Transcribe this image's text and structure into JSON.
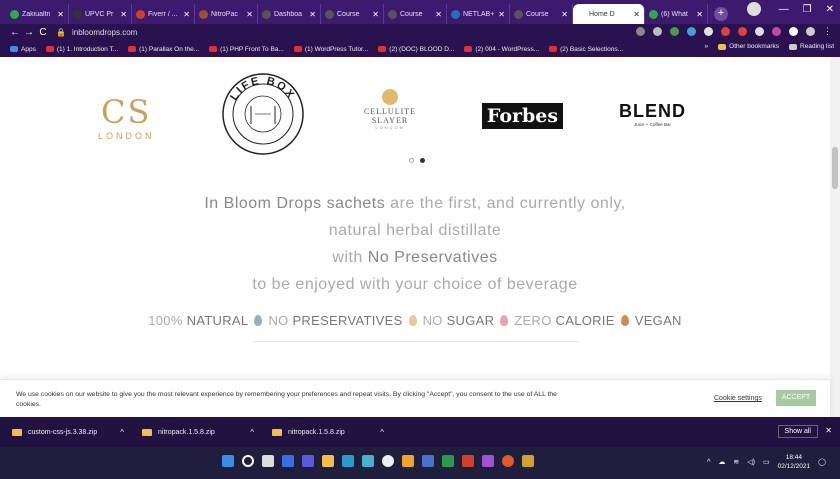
{
  "browser": {
    "tabs": [
      {
        "label": "Zakiualtn",
        "color": "#2eaa4a"
      },
      {
        "label": "UPVC Pr",
        "color": "#333333"
      },
      {
        "label": "Fiverr / ...",
        "color": "#d04030"
      },
      {
        "label": "NitroPac",
        "color": "#a05030"
      },
      {
        "label": "Dashboa",
        "color": "#555555"
      },
      {
        "label": "Course",
        "color": "#555555"
      },
      {
        "label": "Course",
        "color": "#555555"
      },
      {
        "label": "NETLAB+",
        "color": "#2a6cc0"
      },
      {
        "label": "Course",
        "color": "#555555"
      },
      {
        "label": "Home D",
        "color": "#ffffff",
        "active": true
      },
      {
        "label": "(6) What",
        "color": "#2eaa4a"
      }
    ],
    "new_tab": "+",
    "url": "inbloomdrops.com",
    "bookmarks": [
      "Apps",
      "(1) 1. Introduction T...",
      "(1) Parallax On the...",
      "(1) PHP Front To Ba...",
      "(1) WordPress Tutor...",
      "(2) (DOC) BLOOD D...",
      "(2) 004 - WordPress...",
      "(2) Basic Selections..."
    ],
    "bookmarks_more": "»",
    "other_bookmarks": "Other bookmarks",
    "reading_list": "Reading list"
  },
  "logos": {
    "cs_big": "CS",
    "cs_small": "LONDON",
    "lifebox": "LIFE BOX",
    "cellulite_name": "CELLULITE SLAYER",
    "cellulite_loc": "LONDON",
    "forbes": "Forbes",
    "blend": "BLEND",
    "blend_sub": "Juice + Coffee Bar"
  },
  "copy": {
    "line1_a": "In Bloom Drops sachets",
    "line1_b": " are the first, and currently only,",
    "line2": "natural herbal distillate",
    "line3_a": "with ",
    "line3_b": "No Preservatives",
    "line4": "to be enjoyed with your choice of beverage"
  },
  "attributes": [
    {
      "pre": "100% ",
      "word": "NATURAL",
      "drop": "#8fb3b8"
    },
    {
      "pre": "NO ",
      "word": "PRESERVATIVES",
      "drop": "#f0c49a"
    },
    {
      "pre": "NO ",
      "word": "SUGAR",
      "drop": "#f0a0a8"
    },
    {
      "pre": "ZERO ",
      "word": "CALORIE",
      "drop": "#d08a5a"
    },
    {
      "pre": "",
      "word": "VEGAN",
      "drop": null
    }
  ],
  "cookie": {
    "text": "We use cookies on our website to give you the most relevant experience by remembering your preferences and repeat visits. By clicking \"Accept\", you consent to the use of ALL the cookies.",
    "settings": "Cookie settings",
    "accept": "ACCEPT"
  },
  "downloads": {
    "items": [
      "custom-css-js.3.38.zip",
      "nitropack.1.5.8.zip",
      "nitropack.1.5.8.zip"
    ],
    "show_all": "Show all"
  },
  "taskbar": {
    "time": "18:44",
    "date": "02/12/2021"
  }
}
